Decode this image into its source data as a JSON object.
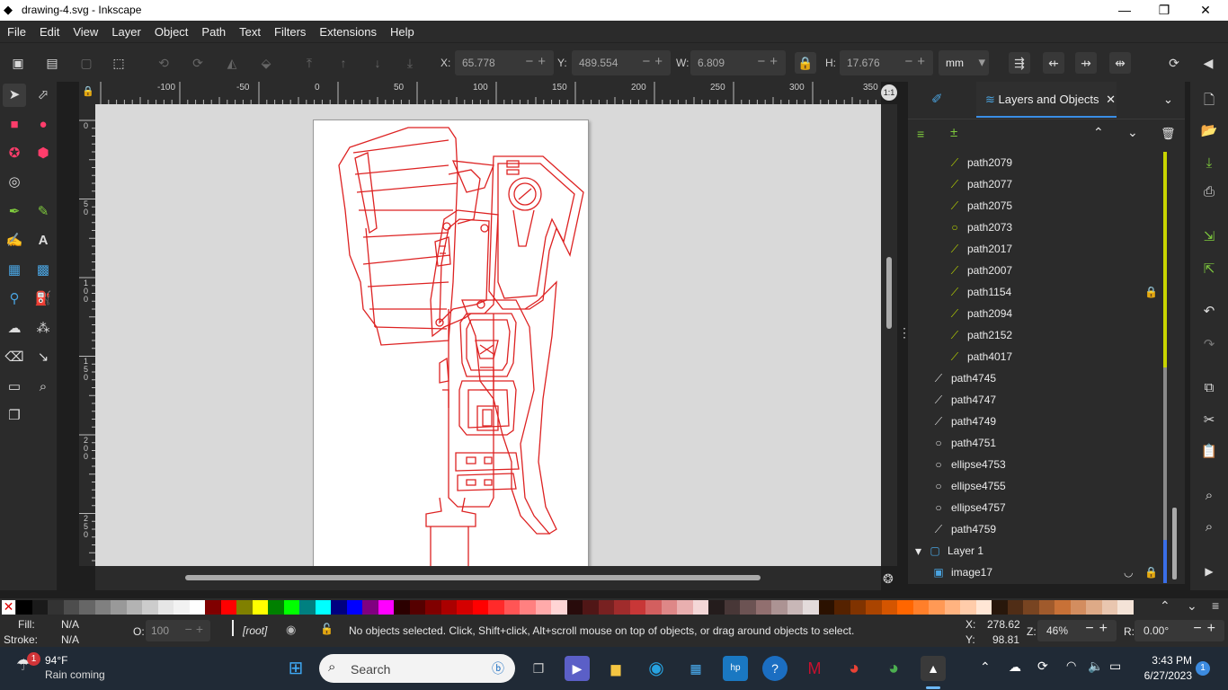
{
  "window": {
    "title": "drawing-4.svg - Inkscape",
    "minimize": "—",
    "maximize": "❐",
    "close": "✕"
  },
  "menu": [
    "File",
    "Edit",
    "View",
    "Layer",
    "Object",
    "Path",
    "Text",
    "Filters",
    "Extensions",
    "Help"
  ],
  "toolctrl": {
    "x_label": "X:",
    "x_value": "65.778",
    "y_label": "Y:",
    "y_value": "489.554",
    "w_label": "W:",
    "w_value": "6.809",
    "h_label": "H:",
    "h_value": "17.676",
    "unit": "mm"
  },
  "ruler_top": [
    "-100",
    "-50",
    "0",
    "50",
    "100",
    "150",
    "200",
    "250",
    "300",
    "350"
  ],
  "ruler_left": [
    "0",
    "5 0",
    "1 0 0",
    "1 5 0",
    "2 0 0",
    "2 5 0"
  ],
  "dock": {
    "tab_label": "Layers and Objects"
  },
  "layers": [
    {
      "name": "path2079",
      "icon": "path-icon",
      "level": 2,
      "bar": "#c8d400"
    },
    {
      "name": "path2077",
      "icon": "path-icon",
      "level": 2,
      "bar": "#c8d400"
    },
    {
      "name": "path2075",
      "icon": "path-icon",
      "level": 2,
      "bar": "#c8d400"
    },
    {
      "name": "path2073",
      "icon": "circle-icon",
      "level": 2,
      "bar": "#c8d400"
    },
    {
      "name": "path2017",
      "icon": "path-icon",
      "level": 2,
      "bar": "#c8d400"
    },
    {
      "name": "path2007",
      "icon": "path-icon",
      "level": 2,
      "bar": "#c8d400"
    },
    {
      "name": "path1154",
      "icon": "path-icon",
      "level": 2,
      "bar": "#c8d400",
      "locked": true
    },
    {
      "name": "path2094",
      "icon": "path-icon",
      "level": 2,
      "bar": "#c8d400"
    },
    {
      "name": "path2152",
      "icon": "path-icon",
      "level": 2,
      "bar": "#c8d400"
    },
    {
      "name": "path4017",
      "icon": "path-icon",
      "level": 2,
      "bar": "#c8d400"
    },
    {
      "name": "path4745",
      "icon": "path-icon",
      "level": 1,
      "bar": "#8a8a8a"
    },
    {
      "name": "path4747",
      "icon": "path-icon",
      "level": 1,
      "bar": "#8a8a8a"
    },
    {
      "name": "path4749",
      "icon": "path-icon",
      "level": 1,
      "bar": "#8a8a8a"
    },
    {
      "name": "path4751",
      "icon": "circle-icon",
      "level": 1,
      "bar": "#8a8a8a"
    },
    {
      "name": "ellipse4753",
      "icon": "circle-icon",
      "level": 1,
      "bar": "#8a8a8a"
    },
    {
      "name": "ellipse4755",
      "icon": "circle-icon",
      "level": 1,
      "bar": "#8a8a8a"
    },
    {
      "name": "ellipse4757",
      "icon": "circle-icon",
      "level": 1,
      "bar": "#8a8a8a"
    },
    {
      "name": "path4759",
      "icon": "path-icon",
      "level": 1,
      "bar": "#8a8a8a"
    },
    {
      "name": "Layer 1",
      "icon": "layer-icon",
      "level": 0,
      "bar": "#3a6ee8",
      "expander": true
    },
    {
      "name": "image17",
      "icon": "image-icon",
      "level": 1,
      "bar": "#3a6ee8",
      "locked": true,
      "hidden": true
    }
  ],
  "palette_colors": [
    "#000000",
    "#1a1a1a",
    "#333333",
    "#4d4d4d",
    "#666666",
    "#808080",
    "#999999",
    "#b3b3b3",
    "#cccccc",
    "#e6e6e6",
    "#f2f2f2",
    "#ffffff",
    "#800000",
    "#ff0000",
    "#808000",
    "#ffff00",
    "#008000",
    "#00ff00",
    "#008080",
    "#00ffff",
    "#000080",
    "#0000ff",
    "#800080",
    "#ff00ff",
    "#2b0000",
    "#550000",
    "#800000",
    "#aa0000",
    "#d40000",
    "#ff0000",
    "#ff2a2a",
    "#ff5555",
    "#ff8080",
    "#ffaaaa",
    "#ffd5d5",
    "#280b0b",
    "#501616",
    "#782121",
    "#a02c2c",
    "#c83737",
    "#d35f5f",
    "#de8787",
    "#e9afaf",
    "#f4d7d7",
    "#241c1c",
    "#483737",
    "#6c5353",
    "#916f6f",
    "#ac9393",
    "#c8b7b7",
    "#e3dbdb",
    "#2b1100",
    "#552200",
    "#803300",
    "#aa4400",
    "#d45500",
    "#ff6600",
    "#ff7f2a",
    "#ff9955",
    "#ffb380",
    "#ffccaa",
    "#ffe6d5",
    "#28170b",
    "#502d16",
    "#784421",
    "#a05a2c",
    "#c87137",
    "#d38d5f",
    "#deaa87",
    "#e9c6af",
    "#f4e3d7"
  ],
  "status": {
    "fill_label": "Fill:",
    "fill_value": "N/A",
    "stroke_label": "Stroke:",
    "stroke_value": "N/A",
    "opacity_label": "O:",
    "opacity_value": "100",
    "layer": "[root]",
    "message": "No objects selected. Click, Shift+click, Alt+scroll mouse on top of objects, or drag around objects to select.",
    "x_label": "X:",
    "x_value": "278.62",
    "y_label": "Y:",
    "y_value": "98.81",
    "zoom_label": "Z:",
    "zoom_value": "46%",
    "rot_label": "R:",
    "rot_value": "0.00°"
  },
  "taskbar": {
    "weather_temp": "94°F",
    "weather_text": "Rain coming",
    "weather_badge": "1",
    "search_placeholder": "Search",
    "time": "3:43 PM",
    "date": "6/27/2023",
    "notif": "1"
  }
}
